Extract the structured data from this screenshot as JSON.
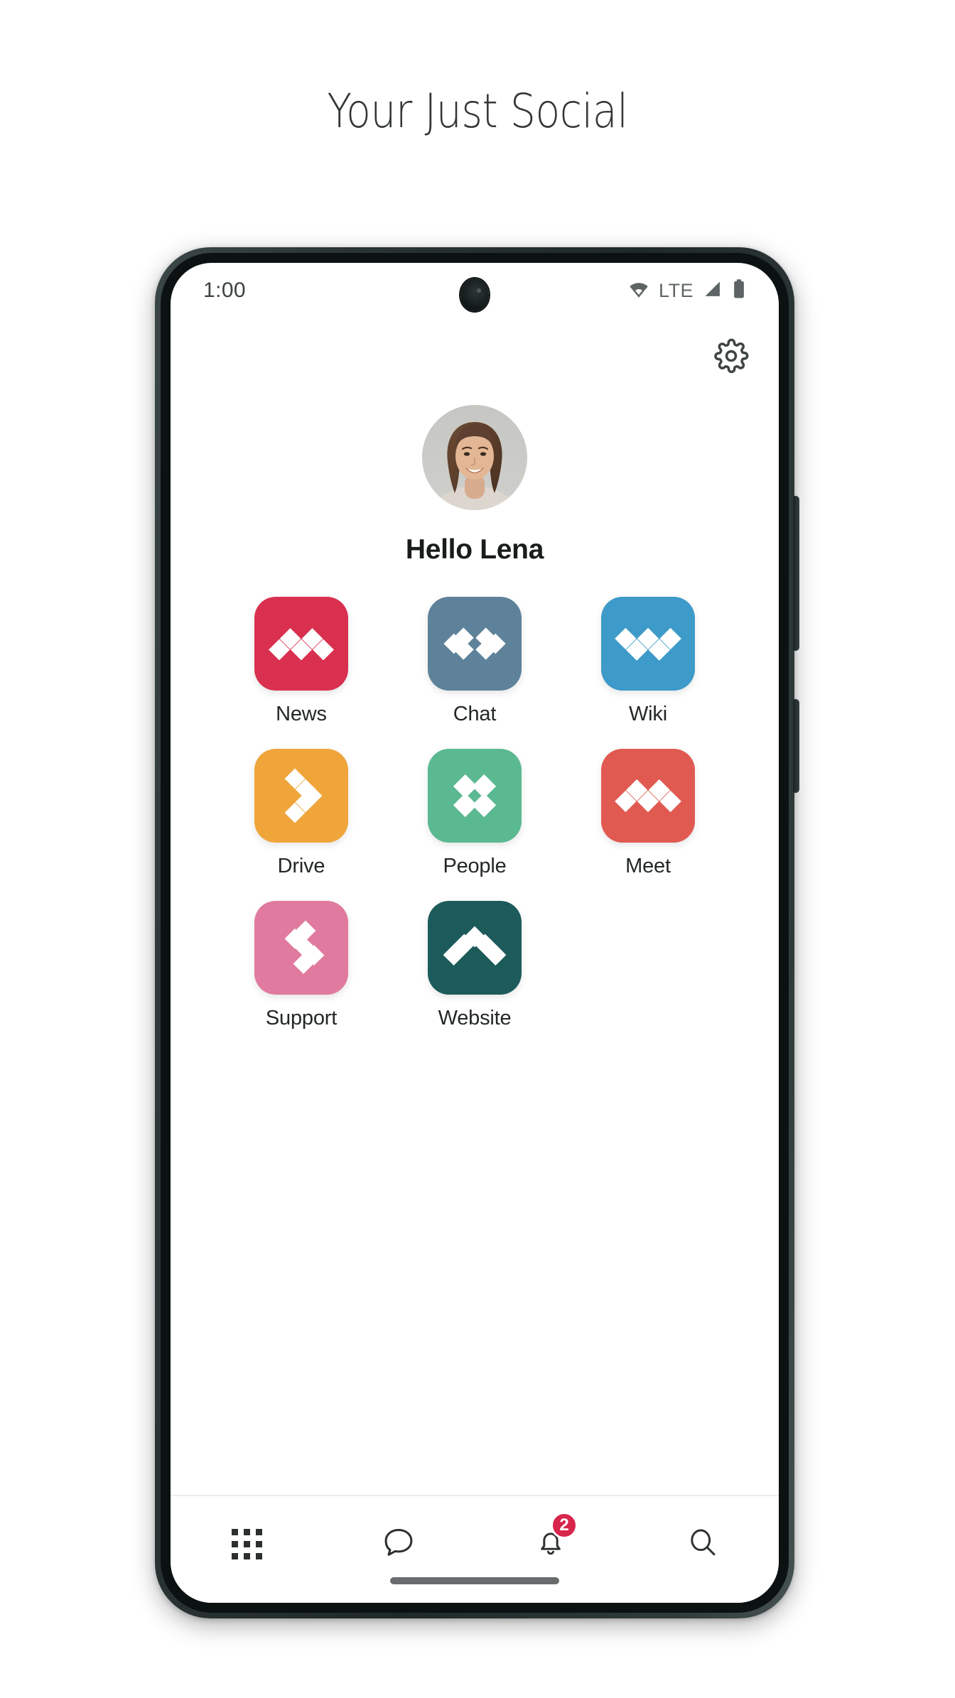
{
  "page": {
    "title": "Your Just Social",
    "background_color": "#ffffff",
    "title_color": "#333638"
  },
  "device": {
    "frame_color": "#2b3434",
    "screen_background": "#ffffff",
    "side_buttons": [
      "volume-rocker",
      "power-button"
    ],
    "home_indicator": true
  },
  "status_bar": {
    "time": "1:00",
    "network_label": "LTE",
    "icons": [
      "wifi-icon",
      "signal-icon",
      "battery-icon"
    ],
    "camera": "punch-hole-camera",
    "color": "#5e6464"
  },
  "header": {
    "settings_icon": "gear-icon"
  },
  "profile": {
    "avatar": "user-avatar-photo",
    "greeting": "Hello Lena"
  },
  "apps": [
    {
      "label": "News",
      "color": "#D9304F",
      "glyph": "m-zigzag",
      "icon": "news-app-icon"
    },
    {
      "label": "Chat",
      "color": "#5E8299",
      "glyph": "double-cluster",
      "icon": "chat-app-icon"
    },
    {
      "label": "Wiki",
      "color": "#3D9AC9",
      "glyph": "w-zigzag",
      "icon": "wiki-app-icon"
    },
    {
      "label": "Drive",
      "color": "#EFA53A",
      "glyph": "chevron-right",
      "icon": "drive-app-icon"
    },
    {
      "label": "People",
      "color": "#5BB992",
      "glyph": "quad-grid",
      "icon": "people-app-icon"
    },
    {
      "label": "Meet",
      "color": "#E05A52",
      "glyph": "m-peaks",
      "icon": "meet-app-icon"
    },
    {
      "label": "Support",
      "color": "#E07A9E",
      "glyph": "s-diagonal",
      "icon": "support-app-icon"
    },
    {
      "label": "Website",
      "color": "#1D5B5B",
      "glyph": "caret-up",
      "icon": "website-app-icon"
    }
  ],
  "bottom_nav": [
    {
      "name": "apps",
      "icon": "grid-icon",
      "badge": null
    },
    {
      "name": "chat",
      "icon": "chat-bubble-icon",
      "badge": null
    },
    {
      "name": "notifications",
      "icon": "bell-icon",
      "badge": "2"
    },
    {
      "name": "search",
      "icon": "search-icon",
      "badge": null
    }
  ],
  "colors": {
    "badge": "#D8254B",
    "icon_stroke": "#2b2f2f",
    "divider": "#ececec"
  }
}
